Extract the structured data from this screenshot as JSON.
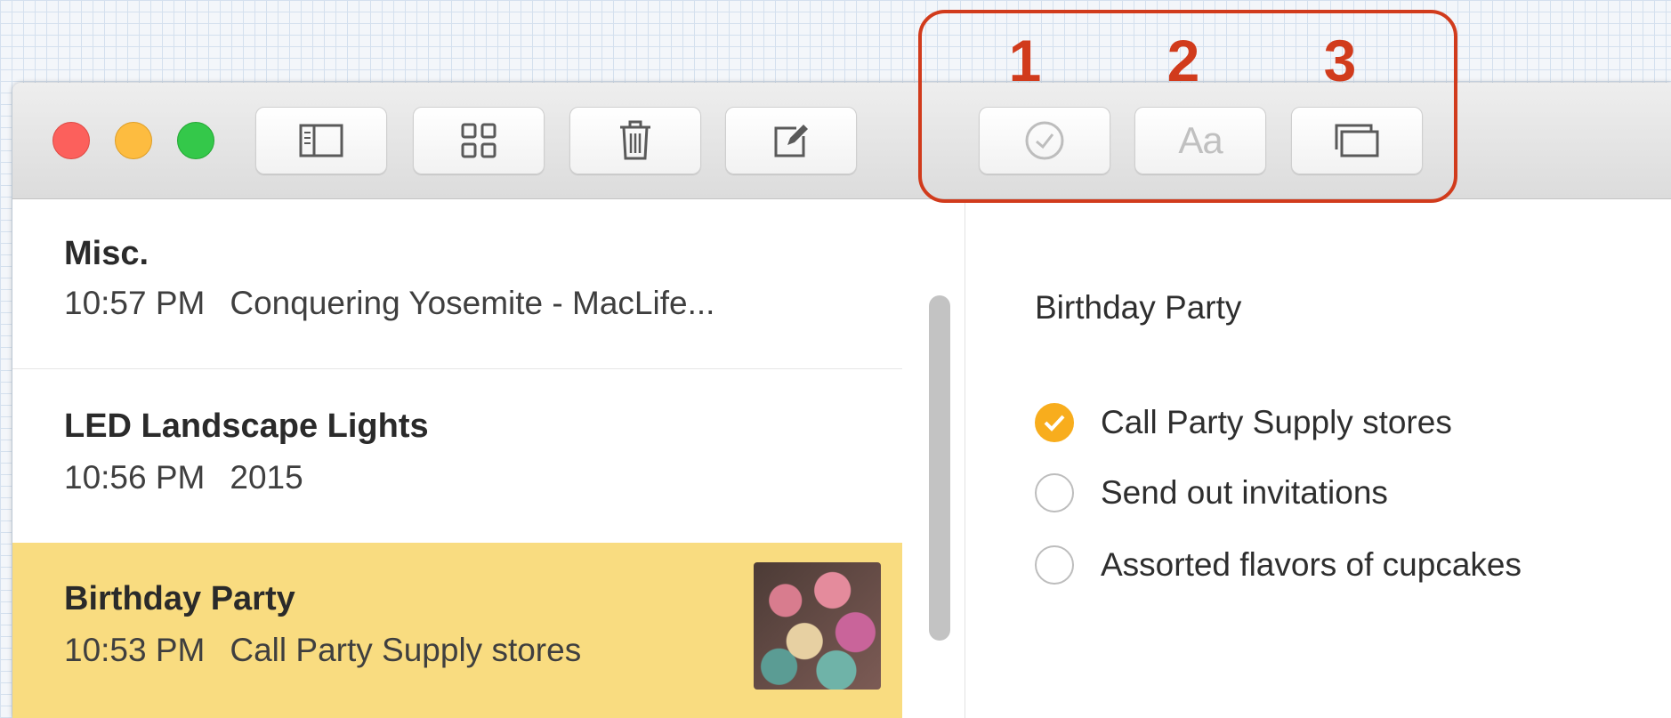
{
  "toolbar": {
    "buttons": [
      {
        "name": "sidebar-toggle",
        "icon": "sidebar-icon"
      },
      {
        "name": "attachments-browser",
        "icon": "grid-icon"
      },
      {
        "name": "delete-note",
        "icon": "trash-icon"
      },
      {
        "name": "new-note",
        "icon": "compose-icon"
      },
      {
        "name": "checklist",
        "icon": "checkmark-circle-icon"
      },
      {
        "name": "format",
        "icon": "text-format-icon",
        "glyph": "Aa"
      },
      {
        "name": "add-photo-media",
        "icon": "windows-icon"
      }
    ]
  },
  "annotation": {
    "labels": [
      "1",
      "2",
      "3"
    ],
    "color": "#d13b1c"
  },
  "notes": [
    {
      "title": "Misc.",
      "time": "10:57 PM",
      "preview": "Conquering Yosemite - MacLife..."
    },
    {
      "title": "LED Landscape Lights",
      "time": "10:56 PM",
      "preview": "2015"
    },
    {
      "title": "Birthday Party",
      "time": "10:53 PM",
      "preview": "Call Party Supply stores",
      "selected": true,
      "has_thumbnail": true
    }
  ],
  "editor": {
    "title": "Birthday Party",
    "checklist": [
      {
        "text": "Call Party Supply stores",
        "checked": true
      },
      {
        "text": "Send out invitations",
        "checked": false
      },
      {
        "text": "Assorted flavors of cupcakes",
        "checked": false
      }
    ]
  },
  "colors": {
    "selected_row": "#f9dc80",
    "check_accent": "#f8ad1d"
  }
}
